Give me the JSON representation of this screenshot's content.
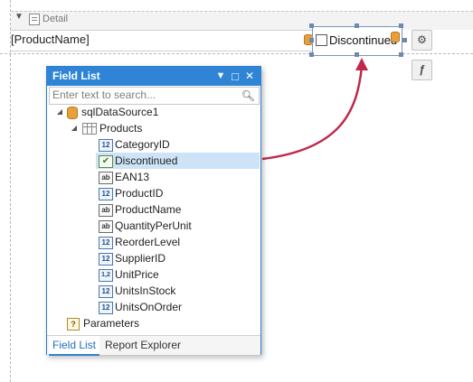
{
  "report": {
    "band": {
      "title": "Detail",
      "collapse_glyph": "▼",
      "icon": "band-icon"
    },
    "product_name_field": "[ProductName]",
    "selected_control": {
      "label": "Discontinued",
      "checked": false
    },
    "side_buttons": [
      {
        "icon": "gear-icon",
        "glyph": "⚙"
      },
      {
        "icon": "function-icon",
        "glyph": "ƒ"
      }
    ],
    "drag_arrow_color": "#c0294a"
  },
  "field_list": {
    "title": "Field List",
    "title_bar_color": "#2f84d6",
    "window_buttons": {
      "dropdown": "▼",
      "maximize": "□",
      "close": "✕"
    },
    "search": {
      "placeholder": "Enter text to search...",
      "value": ""
    },
    "tree": {
      "datasource": {
        "label": "sqlDataSource1",
        "expander": "◢"
      },
      "table": {
        "label": "Products",
        "expander": "◢"
      },
      "fields": [
        {
          "label": "CategoryID",
          "type": "number",
          "glyph": "12"
        },
        {
          "label": "Discontinued",
          "type": "boolean",
          "glyph": "✔",
          "selected": true
        },
        {
          "label": "EAN13",
          "type": "string",
          "glyph": "ab"
        },
        {
          "label": "ProductID",
          "type": "number",
          "glyph": "12"
        },
        {
          "label": "ProductName",
          "type": "string",
          "glyph": "ab"
        },
        {
          "label": "QuantityPerUnit",
          "type": "string",
          "glyph": "ab"
        },
        {
          "label": "ReorderLevel",
          "type": "number",
          "glyph": "12"
        },
        {
          "label": "SupplierID",
          "type": "number",
          "glyph": "12"
        },
        {
          "label": "UnitPrice",
          "type": "decimal",
          "glyph": "1,2"
        },
        {
          "label": "UnitsInStock",
          "type": "number",
          "glyph": "12"
        },
        {
          "label": "UnitsOnOrder",
          "type": "number",
          "glyph": "12"
        }
      ],
      "parameters": {
        "label": "Parameters",
        "glyph": "?"
      }
    },
    "tabs": [
      {
        "label": "Field List",
        "active": true
      },
      {
        "label": "Report Explorer",
        "active": false
      }
    ]
  }
}
